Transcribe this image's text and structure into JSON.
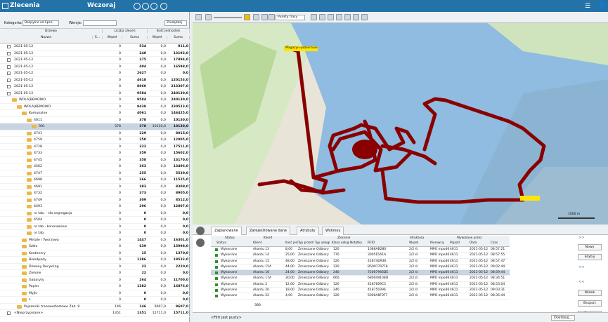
{
  "app": {
    "title": "Zlecenia",
    "day": "Wczoraj"
  },
  "filters": {
    "kategoria_label": "Kategoria:",
    "kategoria_value": "Bezpylne od lipca",
    "wersja_label": "Wersja:",
    "manage": "Zarządzaj"
  },
  "tree_header": {
    "drzewo": "Drzewo",
    "nazwa": "Nazwa",
    "s": "S...",
    "liczba": "Liczba zleceń",
    "ilosc": "Ilość jednostek",
    "wezel": "Węzeł",
    "suma": "Suma",
    "wezel2": "Węzeł",
    "suma2": "Suma"
  },
  "tree_rows": [
    {
      "label": "2021-05-12",
      "c1": "0",
      "c2": "534",
      "c3": "0,0",
      "c4": "911,0",
      "ind": 0
    },
    {
      "label": "2021-05-12",
      "c1": "0",
      "c2": "248",
      "c3": "0,0",
      "c4": "13193,0",
      "ind": 0
    },
    {
      "label": "2021-05-12",
      "c1": "0",
      "c2": "375",
      "c3": "0,0",
      "c4": "17894,0",
      "ind": 0
    },
    {
      "label": "2021-05-12",
      "c1": "0",
      "c2": "404",
      "c3": "0,0",
      "c4": "16598,0",
      "ind": 0
    },
    {
      "label": "2021-05-12",
      "c1": "0",
      "c2": "2627",
      "c3": "0,0",
      "c4": "0,0",
      "ind": 0
    },
    {
      "label": "2021-05-12",
      "c1": "0",
      "c2": "4618",
      "c3": "0,0",
      "c4": "120153,0",
      "ind": 0
    },
    {
      "label": "2021-05-12",
      "c1": "0",
      "c2": "8060",
      "c3": "0,0",
      "c4": "213307,0",
      "ind": 0
    },
    {
      "label": "2021-05-12",
      "c1": "0",
      "c2": "9584",
      "c3": "0,0",
      "c4": "240130,0",
      "ind": 0
    },
    {
      "label": "WOLA|BEMOWO",
      "c1": "0",
      "c2": "9584",
      "c3": "0,0",
      "c4": "240130,0",
      "ind": 1
    },
    {
      "label": "WOLA|BEMOWO",
      "c1": "0",
      "c2": "9438",
      "c3": "0,0",
      "c4": "230523,0",
      "ind": 2
    },
    {
      "label": "Komunalne",
      "c1": "0",
      "c2": "4061",
      "c3": "0,0",
      "c4": "146425,0",
      "ind": 3
    },
    {
      "label": "4611",
      "c1": "0",
      "c2": "378",
      "c3": "0,0",
      "c4": "10130,0",
      "ind": 4
    },
    {
      "label": "901",
      "c1": "378",
      "c2": "378",
      "c3": "10130,0",
      "c4": "10130,0",
      "ind": 5,
      "sel": true
    },
    {
      "label": "4741",
      "c1": "0",
      "c2": "229",
      "c3": "0,0",
      "c4": "8015,0",
      "ind": 4
    },
    {
      "label": "4759",
      "c1": "0",
      "c2": "250",
      "c3": "0,0",
      "c4": "12905,0",
      "ind": 4
    },
    {
      "label": "4728",
      "c1": "0",
      "c2": "322",
      "c3": "0,0",
      "c4": "17511,0",
      "ind": 4
    },
    {
      "label": "4733",
      "c1": "0",
      "c2": "359",
      "c3": "0,0",
      "c4": "15602,0",
      "ind": 4
    },
    {
      "label": "4745",
      "c1": "0",
      "c2": "358",
      "c3": "0,0",
      "c4": "13170,0",
      "ind": 4
    },
    {
      "label": "4562",
      "c1": "0",
      "c2": "363",
      "c3": "0,0",
      "c4": "13496,0",
      "ind": 4
    },
    {
      "label": "4747",
      "c1": "0",
      "c2": "255",
      "c3": "0,0",
      "c4": "5539,0",
      "ind": 4
    },
    {
      "label": "4698",
      "c1": "0",
      "c2": "266",
      "c3": "0,0",
      "c4": "11525,0",
      "ind": 4
    },
    {
      "label": "4691",
      "c1": "0",
      "c2": "383",
      "c3": "0,0",
      "c4": "8308,0",
      "ind": 4
    },
    {
      "label": "4732",
      "c1": "0",
      "c2": "373",
      "c3": "0,0",
      "c4": "8905,0",
      "ind": 4
    },
    {
      "label": "4749",
      "c1": "0",
      "c2": "309",
      "c3": "0,0",
      "c4": "8512,0",
      "ind": 4
    },
    {
      "label": "4491",
      "c1": "0",
      "c2": "296",
      "c3": "0,0",
      "c4": "12807,0",
      "ind": 4
    },
    {
      "label": "nr tab. - sfa segregacja",
      "c1": "0",
      "c2": "0",
      "c3": "0,0",
      "c4": "0,0",
      "ind": 4
    },
    {
      "label": "4504",
      "c1": "0",
      "c2": "0",
      "c3": "0,0",
      "c4": "0,0",
      "ind": 4
    },
    {
      "label": "nr tab - koronawirus",
      "c1": "0",
      "c2": "0",
      "c3": "0,0",
      "c4": "0,0",
      "ind": 4
    },
    {
      "label": "nr tab.",
      "c1": "0",
      "c2": "0",
      "c3": "0,0",
      "c4": "0,0",
      "ind": 4
    },
    {
      "label": "Metale i Tworzywa",
      "c1": "0",
      "c2": "1447",
      "c3": "0,0",
      "c4": "16301,0",
      "ind": 3
    },
    {
      "label": "Szkło",
      "c1": "0",
      "c2": "639",
      "c3": "0,0",
      "c4": "15998,0",
      "ind": 3
    },
    {
      "label": "Kontenery",
      "c1": "0",
      "c2": "15",
      "c3": "0,0",
      "c4": "1370,0",
      "ind": 3
    },
    {
      "label": "Bioodpady",
      "c1": "0",
      "c2": "1386",
      "c3": "0,0",
      "c4": "19532,0",
      "ind": 3
    },
    {
      "label": "Dzwony Recykling",
      "c1": "0",
      "c2": "22",
      "c3": "0,0",
      "c4": "2220,0",
      "ind": 3
    },
    {
      "label": "Zielone",
      "c1": "0",
      "c2": "22",
      "c3": "0,0",
      "c4": "0,0",
      "ind": 3
    },
    {
      "label": "Gabaryty",
      "c1": "0",
      "c2": "264",
      "c3": "0,0",
      "c4": "11700,0",
      "ind": 3
    },
    {
      "label": "Papier",
      "c1": "0",
      "c2": "1382",
      "c3": "0,0",
      "c4": "16876,0",
      "ind": 3
    },
    {
      "label": "Myjki",
      "c1": "0",
      "c2": "0",
      "c3": "0,0",
      "c4": "0,0",
      "ind": 3
    },
    {
      "label": "s",
      "c1": "0",
      "c2": "0",
      "c3": "0,0",
      "c4": "0,0",
      "ind": 3
    },
    {
      "label": "Pojemniki trasowe/testowe Zad. 9",
      "c1": "146",
      "c2": "146",
      "c3": "9607,0",
      "c4": "9607,0",
      "ind": 2
    },
    {
      "label": "<Nieprzypisane>",
      "c1": "1351",
      "c2": "1351",
      "c3": "15711,0",
      "c4": "15711,0",
      "ind": 0
    }
  ],
  "map": {
    "points_label": "Punkty trasy",
    "scale": "1000 m",
    "tag": "Magazyn-pobieranie"
  },
  "tabs": [
    "Zaplanowane",
    "Zarejestrowane dane",
    "Atrybuty",
    "Wykresy"
  ],
  "grid_header": {
    "status": "Status",
    "klient": "Klient",
    "zlecenie": "Zlecenie",
    "struktura": "Struktura",
    "wykonane": "Wykonane przez",
    "s_status": "Status",
    "s_klient": "Klient",
    "ilosc": "Ilość jed",
    "typ_przed": "Typ przedr",
    "typ_uslugi": "Typ usługi",
    "klasa": "Klasa usług",
    "notatka": "Notatka",
    "rfid": "RFID",
    "wezel": "Węzeł",
    "kierowca": "Kierowcą",
    "pojazd": "Pojazd",
    "data": "Data",
    "czas": "Czas"
  },
  "grid_rows": [
    {
      "status": "Wykonane",
      "klient": "Akantu 13",
      "ilosc": "8,00",
      "typ": "Zmieszane",
      "usl": "Odbiory",
      "kl": "120",
      "rfid": "1086AB280",
      "wz": "2/2 śr",
      "kier": "MPO mpo46",
      "poj": "4611",
      "data": "2021-05-12",
      "czas": "08:57:21"
    },
    {
      "status": "Wykonane",
      "klient": "Akantu 14",
      "ilosc": "25,00",
      "typ": "Zmieszane",
      "usl": "Odbiory",
      "kl": "770",
      "rfid": "3005E5A1A",
      "wz": "2/2 śr",
      "kier": "MPO mpo46",
      "poj": "4611",
      "data": "2021-05-12",
      "czas": "08:57:55"
    },
    {
      "status": "Wykonane",
      "klient": "Akantu 15",
      "ilosc": "48,00",
      "typ": "Zmieszane",
      "usl": "Odbiory",
      "kl": "120",
      "rfid": "41874D936",
      "wz": "2/2 śr",
      "kier": "MPO mpo46",
      "poj": "4611",
      "data": "2021-05-12",
      "czas": "08:57:47"
    },
    {
      "status": "Wykonane",
      "klient": "Akantu 15A",
      "ilosc": "44,00",
      "typ": "Zmieszane",
      "usl": "Odbiory",
      "kl": "120",
      "rfid": "B5007707F8",
      "wz": "2/2 śr",
      "kier": "MPO mpo46",
      "poj": "4611",
      "data": "2021-05-12",
      "czas": "09:02:44"
    },
    {
      "status": "Wykonane",
      "klient": "Akantu 16",
      "ilosc": "24,00",
      "typ": "Zmieszane",
      "usl": "Odbiory",
      "kl": "240",
      "rfid": "72007946DE",
      "wz": "2/2 śr",
      "kier": "MPO mpo46",
      "poj": "4611",
      "data": "2021-05-12",
      "czas": "08:59:44",
      "hl": true
    },
    {
      "status": "Wykonane",
      "klient": "Akantu 17A",
      "ilosc": "30,00",
      "typ": "Zmieszane",
      "usl": "Odbiory",
      "kl": "660",
      "rfid": "680049108D",
      "wz": "2/2 śr",
      "kier": "MPO mpo46",
      "poj": "4611",
      "data": "2021-05-12",
      "czas": "08:34:51"
    },
    {
      "status": "Wykonane",
      "klient": "Akantu 2",
      "ilosc": "12,00",
      "typ": "Zmieszane",
      "usl": "Odbiory",
      "kl": "120",
      "rfid": "4187609C5",
      "wz": "2/2 śr",
      "kier": "MPO mpo46",
      "poj": "4611",
      "data": "2021-05-12",
      "czas": "08:53:04"
    },
    {
      "status": "Wykonane",
      "klient": "Akantu 20",
      "ilosc": "18,00",
      "typ": "Zmieszane",
      "usl": "Odbiory",
      "kl": "240",
      "rfid": "418750396",
      "wz": "2/2 śr",
      "kier": "MPO mpo46",
      "poj": "4611",
      "data": "2021-05-12",
      "czas": "09:03:31"
    },
    {
      "status": "Wykonane",
      "klient": "Akantu 22",
      "ilosc": "4,00",
      "typ": "Zmieszane",
      "usl": "Odbiory",
      "kl": "120",
      "rfid": "5000A8F0F7",
      "wz": "2/2 śr",
      "kier": "MPO mpo46",
      "poj": "4611",
      "data": "2021-05-12",
      "czas": "08:35:44"
    }
  ],
  "grid_count": "380",
  "filter_empty": "<Filtr jest pusty>",
  "customize": "Dostosuj...",
  "buttons": {
    "nowy": "Nowy",
    "edytuj": "Edytuj",
    "widok": "Widok",
    "eksport": "Eksport",
    "drukuj": "Drukuj"
  }
}
